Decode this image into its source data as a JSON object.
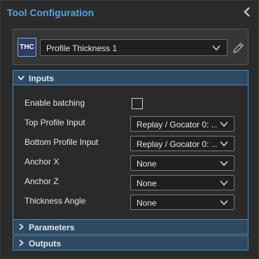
{
  "header": {
    "title": "Tool Configuration"
  },
  "tool": {
    "badge": "THC",
    "selected": "Profile Thickness 1"
  },
  "sections": {
    "inputs": "Inputs",
    "parameters": "Parameters",
    "outputs": "Outputs"
  },
  "inputs": {
    "enable_batching": {
      "label": "Enable batching",
      "checked": false
    },
    "top_profile": {
      "label": "Top Profile Input",
      "value": "Replay / Gocator 0: ..."
    },
    "bottom_profile": {
      "label": "Bottom Profile Input",
      "value": "Replay / Gocator 0: ..."
    },
    "anchor_x": {
      "label": "Anchor X",
      "value": "None"
    },
    "anchor_z": {
      "label": "Anchor Z",
      "value": "None"
    },
    "thickness_angle": {
      "label": "Thickness Angle",
      "value": "None"
    }
  },
  "colors": {
    "accent": "#4aa8e8",
    "section_header_bg": "#2e4a63",
    "section_border": "#4d87b3",
    "panel_bg": "#2b2b2b"
  },
  "icons": {
    "collapse": "chevron-left-icon",
    "dropdown": "chevron-down-icon",
    "edit": "pencil-icon",
    "expanded": "chevron-down-icon",
    "collapsed": "chevron-right-icon"
  }
}
